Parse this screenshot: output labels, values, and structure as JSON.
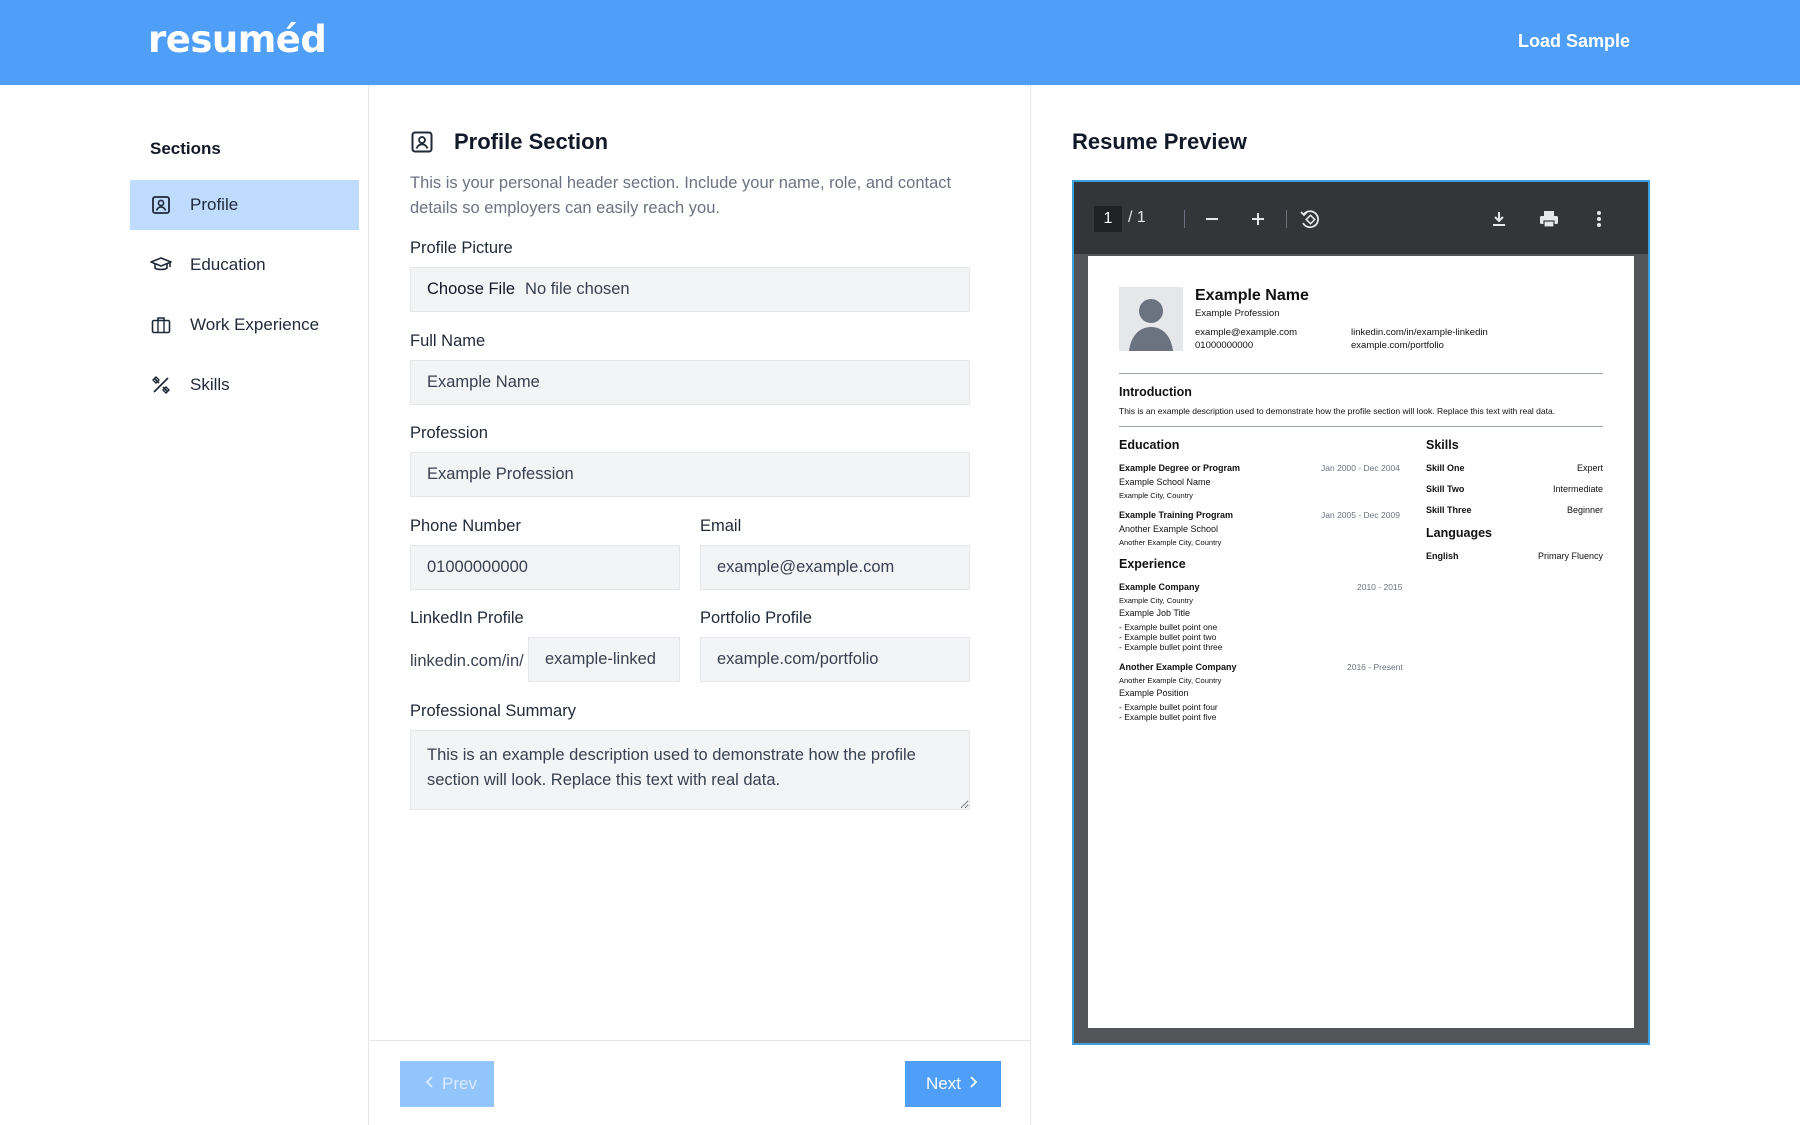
{
  "header": {
    "logo": "resuméd",
    "load_sample": "Load Sample"
  },
  "sidebar": {
    "title": "Sections",
    "items": [
      {
        "label": "Profile",
        "icon": "profile-icon"
      },
      {
        "label": "Education",
        "icon": "graduation-cap-icon"
      },
      {
        "label": "Work Experience",
        "icon": "briefcase-icon"
      },
      {
        "label": "Skills",
        "icon": "tools-icon"
      }
    ]
  },
  "form": {
    "title": "Profile Section",
    "description": "This is your personal header section. Include your name, role, and contact details so employers can easily reach you.",
    "picture_label": "Profile Picture",
    "file_button": "Choose File",
    "file_status": "No file chosen",
    "full_name_label": "Full Name",
    "full_name_value": "Example Name",
    "profession_label": "Profession",
    "profession_value": "Example Profession",
    "phone_label": "Phone Number",
    "phone_value": "01000000000",
    "email_label": "Email",
    "email_value": "example@example.com",
    "linkedin_label": "LinkedIn Profile",
    "linkedin_prefix": "linkedin.com/in/",
    "linkedin_value": "example-linked",
    "portfolio_label": "Portfolio Profile",
    "portfolio_value": "example.com/portfolio",
    "summary_label": "Professional Summary",
    "summary_value": "This is an example description used to demonstrate how the profile section will look. Replace this text with real data.",
    "prev_label": "Prev",
    "next_label": "Next"
  },
  "preview": {
    "title": "Resume Preview",
    "viewer": {
      "page_current": "1",
      "page_total": "/ 1"
    },
    "resume": {
      "name": "Example Name",
      "profession": "Example Profession",
      "email": "example@example.com",
      "phone": "01000000000",
      "linkedin": "linkedin.com/in/example-linkedin",
      "portfolio": "example.com/portfolio",
      "intro_heading": "Introduction",
      "intro_text": "This is an example description used to demonstrate how the profile section will look. Replace this text with real data.",
      "education_heading": "Education",
      "education": [
        {
          "title": "Example Degree or Program",
          "school": "Example School Name",
          "location": "Example City, Country",
          "dates": "Jan 2000 - Dec 2004"
        },
        {
          "title": "Example Training Program",
          "school": "Another Example School",
          "location": "Another Example City, Country",
          "dates": "Jan 2005 - Dec 2009"
        }
      ],
      "experience_heading": "Experience",
      "experience": [
        {
          "company": "Example Company",
          "location": "Example City, Country",
          "role": "Example Job Title",
          "dates": "2010 - 2015",
          "bullets": [
            "- Example bullet point one",
            "- Example bullet point two",
            "- Example bullet point three"
          ]
        },
        {
          "company": "Another Example Company",
          "location": "Another Example City, Country",
          "role": "Example Position",
          "dates": "2016 - Present",
          "bullets": [
            "- Example bullet point four",
            "- Example bullet point five"
          ]
        }
      ],
      "skills_heading": "Skills",
      "skills": [
        {
          "name": "Skill One",
          "level": "Expert"
        },
        {
          "name": "Skill Two",
          "level": "Intermediate"
        },
        {
          "name": "Skill Three",
          "level": "Beginner"
        }
      ],
      "languages_heading": "Languages",
      "languages": [
        {
          "name": "English",
          "level": "Primary Fluency"
        }
      ]
    }
  },
  "colors": {
    "brand": "#4f9ef8",
    "active_nav": "#bfdbfe",
    "viewer_bg": "#525659",
    "viewer_toolbar": "#323639"
  }
}
